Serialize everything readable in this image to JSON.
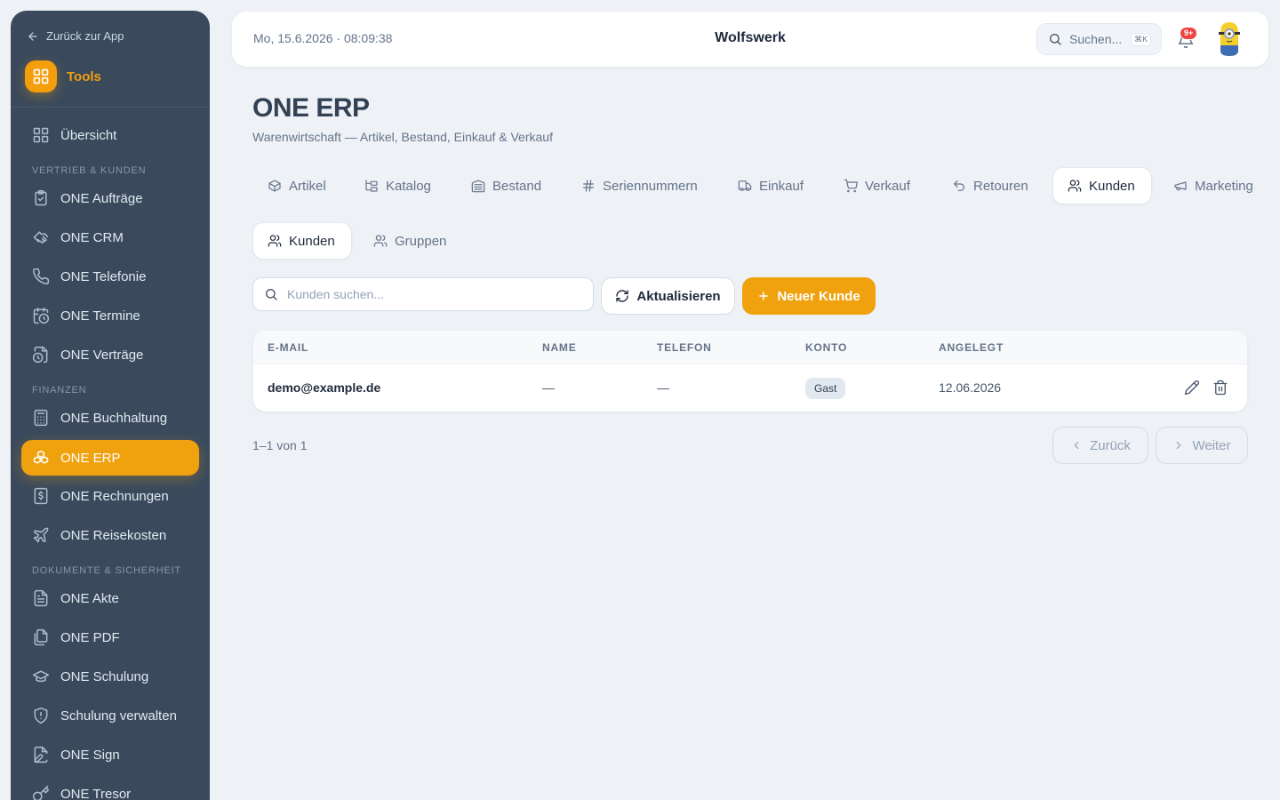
{
  "sidebar": {
    "back_label": "Zurück zur App",
    "tools_label": "Tools",
    "sections": [
      "Vertrieb & Kunden",
      "Finanzen",
      "Dokumente & Sicherheit"
    ],
    "items": [
      {
        "label": "Übersicht",
        "icon": "grid-icon"
      },
      {
        "label": "ONE Aufträge",
        "icon": "clipboard-check-icon"
      },
      {
        "label": "ONE CRM",
        "icon": "handshake-icon"
      },
      {
        "label": "ONE Telefonie",
        "icon": "phone-icon"
      },
      {
        "label": "ONE Termine",
        "icon": "calendar-clock-icon"
      },
      {
        "label": "ONE Verträge",
        "icon": "file-clock-icon"
      },
      {
        "label": "ONE Buchhaltung",
        "icon": "calculator-icon"
      },
      {
        "label": "ONE ERP",
        "icon": "boxes-icon",
        "active": true
      },
      {
        "label": "ONE Rechnungen",
        "icon": "receipt-dollar-icon"
      },
      {
        "label": "ONE Reisekosten",
        "icon": "plane-icon"
      },
      {
        "label": "ONE Akte",
        "icon": "file-text-icon"
      },
      {
        "label": "ONE PDF",
        "icon": "files-icon"
      },
      {
        "label": "ONE Schulung",
        "icon": "graduation-cap-icon"
      },
      {
        "label": "Schulung verwalten",
        "icon": "shield-icon"
      },
      {
        "label": "ONE Sign",
        "icon": "file-signature-icon"
      },
      {
        "label": "ONE Tresor",
        "icon": "key-icon"
      }
    ]
  },
  "topbar": {
    "datetime": "Mo, 15.6.2026 · 08:09:38",
    "company": "Wolfswerk",
    "search_placeholder": "Suchen...",
    "search_shortcut": "⌘K",
    "notifications_badge": "9+"
  },
  "page": {
    "title": "ONE ERP",
    "subtitle": "Warenwirtschaft — Artikel, Bestand, Einkauf & Verkauf"
  },
  "tabs": [
    {
      "label": "Artikel",
      "icon": "package-icon"
    },
    {
      "label": "Katalog",
      "icon": "folder-tree-icon"
    },
    {
      "label": "Bestand",
      "icon": "warehouse-icon"
    },
    {
      "label": "Seriennummern",
      "icon": "hash-icon"
    },
    {
      "label": "Einkauf",
      "icon": "truck-icon"
    },
    {
      "label": "Verkauf",
      "icon": "cart-icon"
    },
    {
      "label": "Retouren",
      "icon": "undo-icon"
    },
    {
      "label": "Kunden",
      "icon": "users-icon",
      "active": true
    },
    {
      "label": "Marketing",
      "icon": "megaphone-icon"
    }
  ],
  "subtabs": [
    {
      "label": "Kunden",
      "icon": "users-icon",
      "active": true
    },
    {
      "label": "Gruppen",
      "icon": "users-icon"
    }
  ],
  "toolbar": {
    "search_placeholder": "Kunden suchen...",
    "search_value": "",
    "refresh_label": "Aktualisieren",
    "new_label": "Neuer Kunde"
  },
  "table": {
    "columns": [
      "E-Mail",
      "Name",
      "Telefon",
      "Konto",
      "Angelegt"
    ],
    "rows": [
      {
        "email": "demo@example.de",
        "name": "—",
        "phone": "—",
        "account": "Gast",
        "created": "12.06.2026"
      }
    ]
  },
  "pagination": {
    "range": "1–1 von 1",
    "prev_label": "Zurück",
    "next_label": "Weiter"
  },
  "colors": {
    "accent": "#f0a10e",
    "sidebar_bg": "#3a4a5c",
    "page_bg": "#eef1f5",
    "badge_red": "#ef4444"
  }
}
